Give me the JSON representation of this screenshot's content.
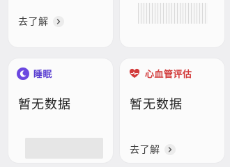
{
  "cards": {
    "top_left": {
      "learn_more": "去了解"
    },
    "sleep": {
      "title": "睡眠",
      "status": "暂无数据",
      "icon": "moon-icon"
    },
    "cardio": {
      "title": "心血管评估",
      "status": "暂无数据",
      "learn_more": "去了解",
      "icon": "heart-pulse-icon"
    }
  },
  "colors": {
    "sleep_accent": "#6b47e0",
    "cardio_accent": "#d23a3a",
    "background": "#efeff1",
    "card": "#fbfbfb"
  }
}
